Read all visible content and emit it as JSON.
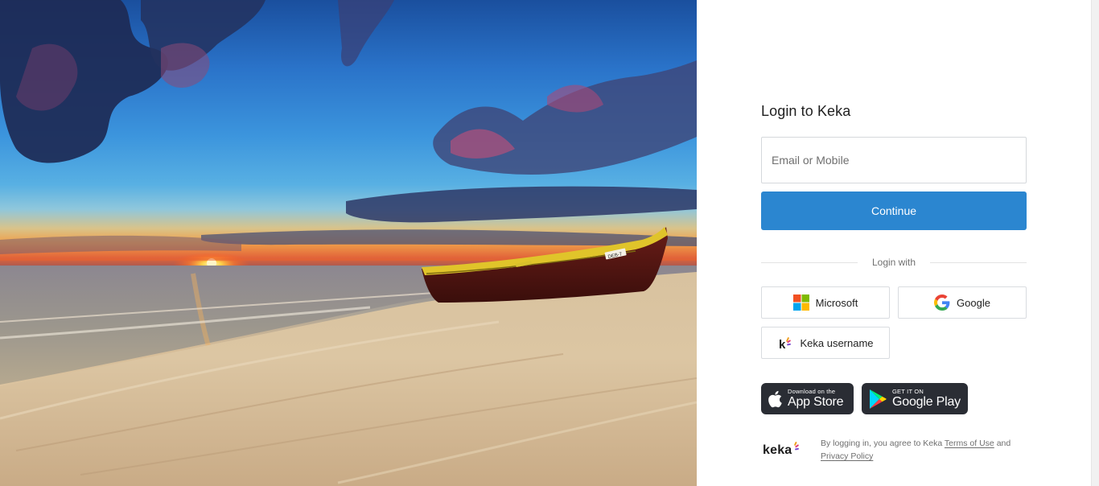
{
  "login": {
    "title": "Login to Keka",
    "email_placeholder": "Email or Mobile",
    "continue_label": "Continue",
    "divider_label": "Login with"
  },
  "sso": {
    "microsoft_label": "Microsoft",
    "google_label": "Google",
    "keka_label": "Keka username"
  },
  "stores": {
    "apple_small": "Download on the",
    "apple_big": "App Store",
    "google_small": "GET IT ON",
    "google_big": "Google Play"
  },
  "boat_label": "DEB-7",
  "footer": {
    "logo_text": "keka",
    "legal_prefix": "By logging in, you agree to Keka",
    "terms_label": "Terms of Use",
    "and_label": "and",
    "privacy_label": "Privacy Policy"
  },
  "colors": {
    "primary_button": "#2b86d0",
    "store_badge": "#2a2d34",
    "microsoft_red": "#f25022",
    "microsoft_green": "#7fba00",
    "microsoft_blue": "#00a4ef",
    "microsoft_yellow": "#ffb900"
  },
  "icons": {
    "microsoft": "microsoft-logo-icon",
    "google": "google-logo-icon",
    "keka": "keka-logo-icon",
    "apple": "apple-icon",
    "play": "google-play-icon"
  }
}
